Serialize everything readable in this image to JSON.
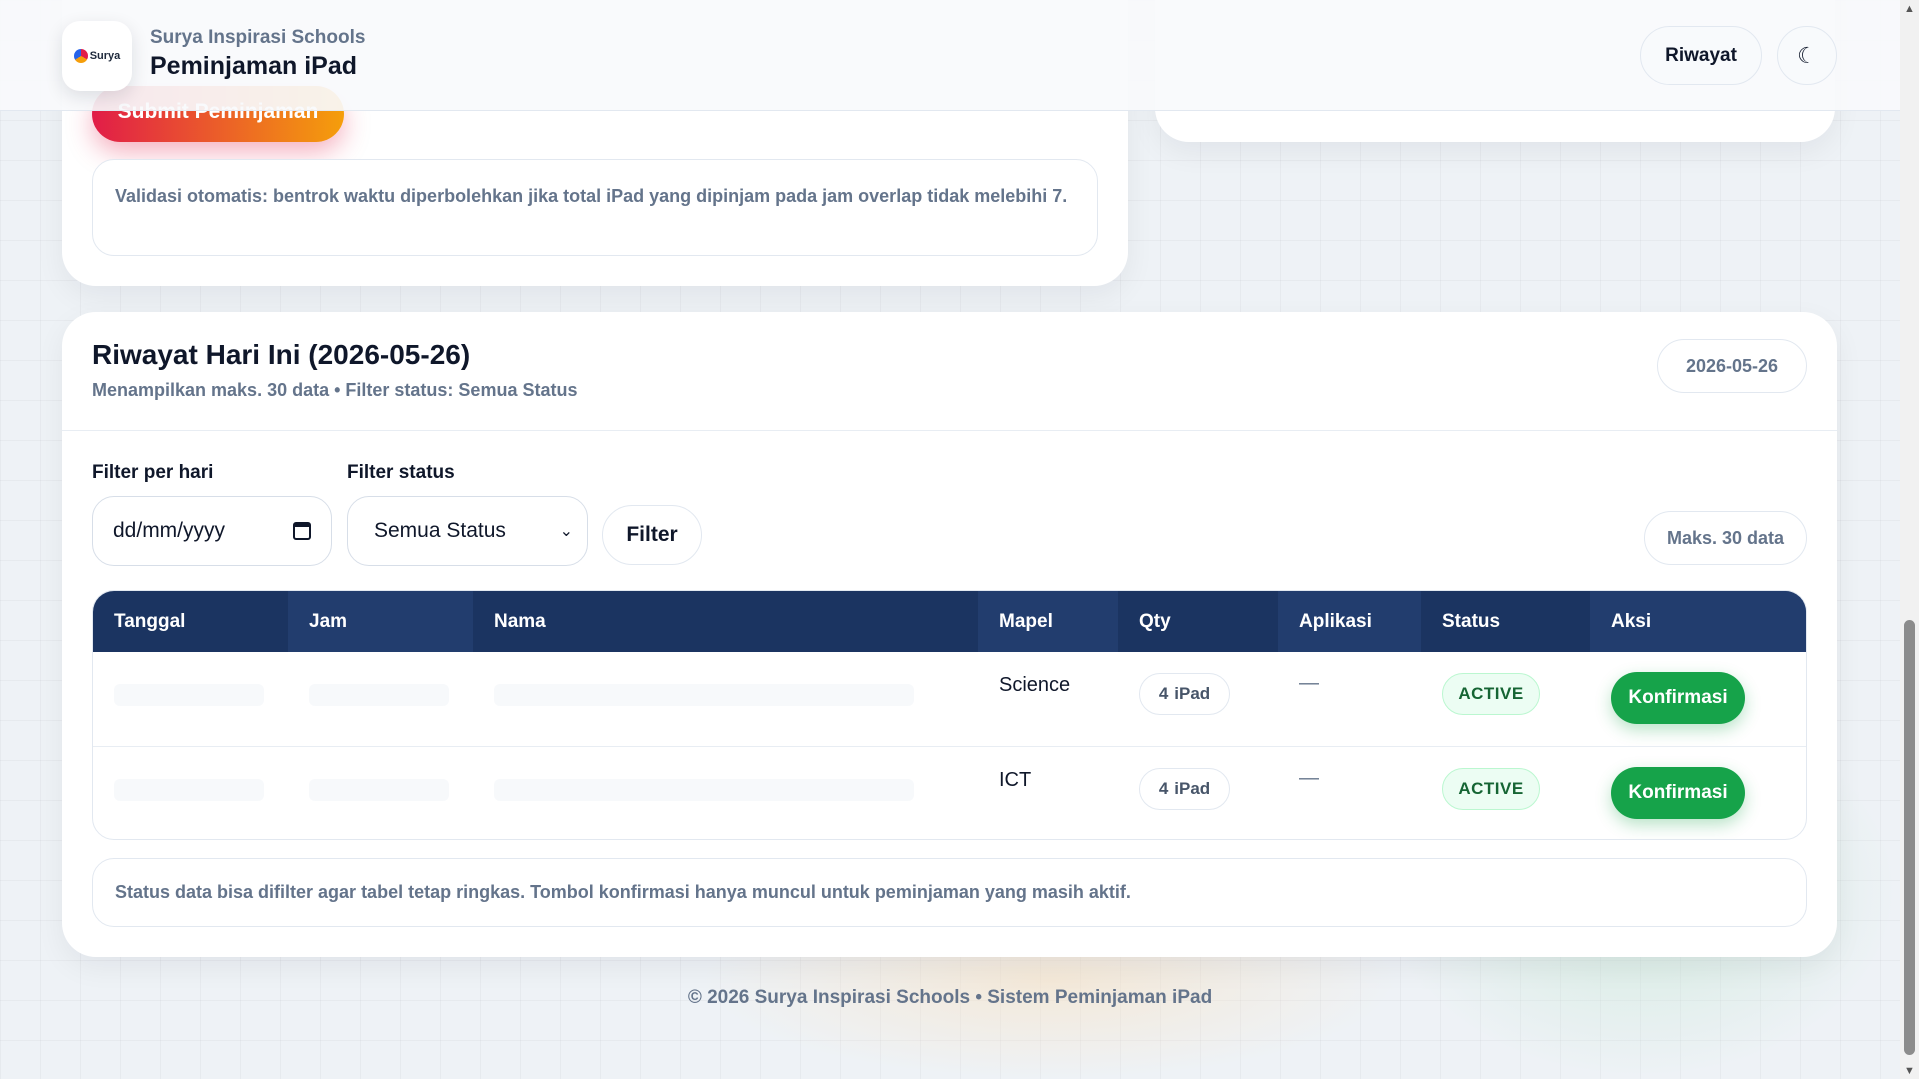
{
  "header": {
    "school_name": "Surya Inspirasi Schools",
    "app_title": "Peminjaman iPad",
    "logo_text": "Surya",
    "riwayat_label": "Riwayat",
    "theme_icon": "☾"
  },
  "form": {
    "submit_label": "Submit Peminjaman",
    "validasi_note": "Validasi otomatis: bentrok waktu diperbolehkan jika total iPad yang dipinjam pada jam overlap tidak melebihi 7."
  },
  "history": {
    "title": "Riwayat Hari Ini (2026-05-26)",
    "subtitle": "Menampilkan maks. 30 data • Filter status: Semua Status",
    "date_badge": "2026-05-26",
    "filter_day_label": "Filter per hari",
    "filter_status_label": "Filter status",
    "date_placeholder": "dd/mm/yyyy",
    "status_selected": "Semua Status",
    "filter_button": "Filter",
    "max_badge": "Maks. 30 data",
    "columns": [
      "Tanggal",
      "Jam",
      "Nama",
      "Mapel",
      "Qty",
      "Aplikasi",
      "Status",
      "Aksi"
    ],
    "rows": [
      {
        "mapel": "Science",
        "qty_num": "4",
        "qty_unit": "iPad",
        "aplikasi": "—",
        "status": "ACTIVE",
        "aksi": "Konfirmasi"
      },
      {
        "mapel": "ICT",
        "qty_num": "4",
        "qty_unit": "iPad",
        "aplikasi": "—",
        "status": "ACTIVE",
        "aksi": "Konfirmasi"
      }
    ],
    "note": "Status data bisa difilter agar tabel tetap ringkas. Tombol konfirmasi hanya muncul untuk peminjaman yang masih aktif."
  },
  "footer": {
    "text": "© 2026 Surya Inspirasi Schools • Sistem Peminjaman iPad"
  },
  "colors": {
    "table_header": "#1b3461",
    "accent_green": "#16a34a",
    "submit_gradient_start": "#e11d48",
    "submit_gradient_end": "#f59e0b"
  }
}
